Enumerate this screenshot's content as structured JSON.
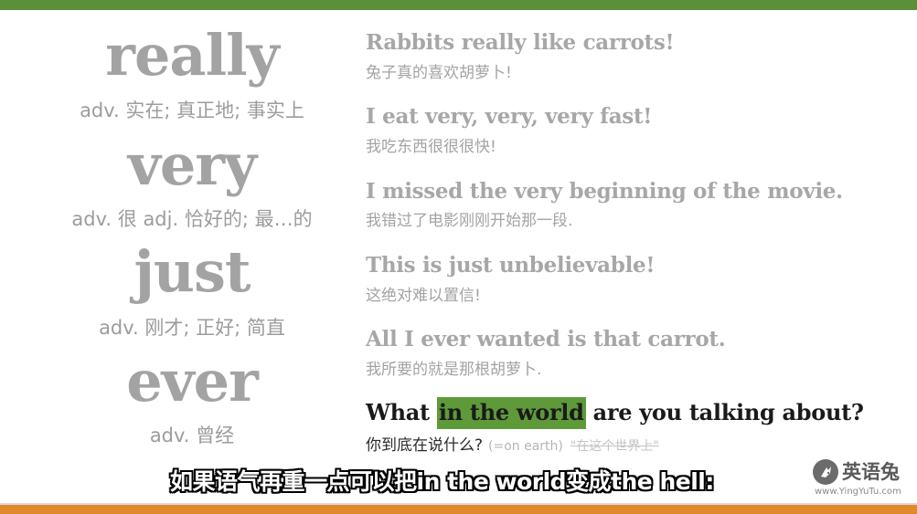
{
  "vocab": [
    {
      "word": "really",
      "definition": "adv. 实在; 真正地; 事实上"
    },
    {
      "word": "very",
      "definition": "adv. 很  adj. 恰好的; 最…的"
    },
    {
      "word": "just",
      "definition": "adv. 刚才; 正好; 简直"
    },
    {
      "word": "ever",
      "definition": "adv. 曾经"
    }
  ],
  "sentences": [
    {
      "en": "Rabbits really like carrots!",
      "zh": "兔子真的喜欢胡萝卜!"
    },
    {
      "en": "I eat very, very, very fast!",
      "zh": "我吃东西很很很快!"
    },
    {
      "en": "I missed the very beginning of the movie.",
      "zh": "我错过了电影刚刚开始那一段."
    },
    {
      "en": "This is just unbelievable!",
      "zh": "这绝对难以置信!"
    },
    {
      "en": "All I ever wanted is that carrot.",
      "zh": "我所要的就是那根胡萝卜."
    }
  ],
  "active_sentence": {
    "before": "What ",
    "highlight": "in the world",
    "after": " are you talking about?",
    "zh": "你到底在说什么?",
    "note": "(=on earth)",
    "struck": "\"在这个世界上\""
  },
  "subtitle": "如果语气再重一点可以把in the world变成the hell:",
  "logo": {
    "name": "英语兔",
    "url": "www.YingYuTu.com",
    "icon": "rabbit-logo-icon"
  },
  "colors": {
    "top_bar": "#5b8f3a",
    "bottom_bar": "#e08a2b",
    "highlight": "#5e9a3a"
  }
}
